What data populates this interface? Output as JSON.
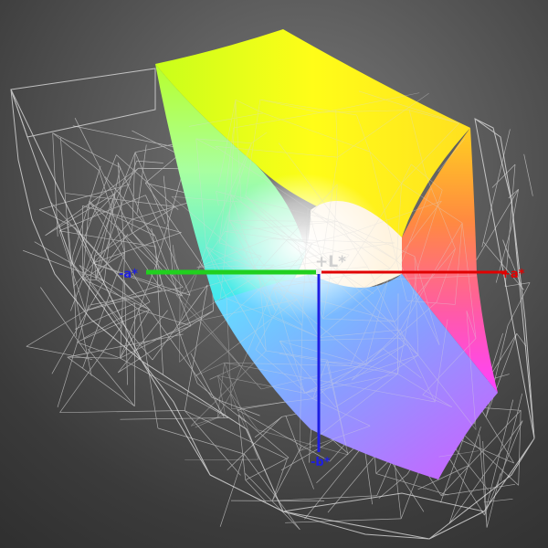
{
  "axes": {
    "l_plus": {
      "label": "+L*",
      "color": "#d0d0d0"
    },
    "a_minus": {
      "label": "-a*",
      "color": "#21d01f"
    },
    "a_plus": {
      "label": "+a*",
      "color": "#e10000"
    },
    "b_minus": {
      "label": "-b*",
      "color": "#1f1fe0"
    }
  },
  "colors": {
    "wireframe": "#e6e6e6",
    "background_top": "#7a7a7a",
    "background_bottom": "#2f2f2f"
  }
}
